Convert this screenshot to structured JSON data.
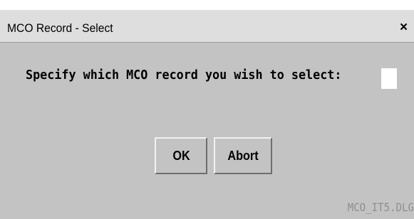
{
  "window": {
    "title": "MCO Record - Select",
    "close_label": "×"
  },
  "dialog": {
    "prompt": "Specify which MCO record you wish to select:",
    "record_input_value": "",
    "ok_label": "OK",
    "abort_label": "Abort",
    "dialog_id": "MCO_IT5.DLG"
  },
  "colors": {
    "titlebar_bg": "#dedede",
    "dialog_bg": "#c3c3c3",
    "input_bg": "#ffffff",
    "footer_text": "#8e8e8e"
  }
}
